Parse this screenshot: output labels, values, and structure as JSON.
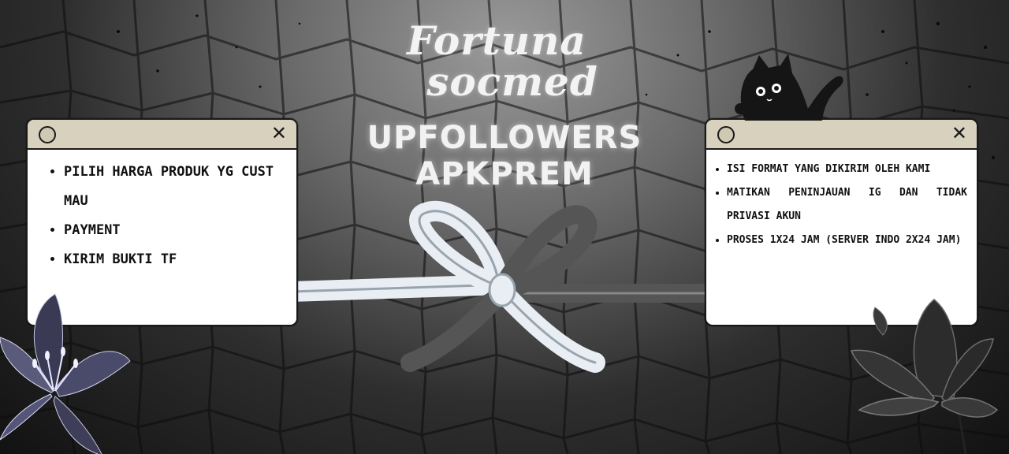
{
  "brand": {
    "line1": "Fortuna",
    "line2": "socmed"
  },
  "headline": {
    "line1": "UPFOLLOWERS",
    "line2": "APKPREM"
  },
  "left_window": {
    "close_symbol": "✕",
    "items": [
      "PILIH HARGA PRODUK YG CUST MAU",
      "PAYMENT",
      "KIRIM BUKTI TF"
    ]
  },
  "right_window": {
    "close_symbol": "✕",
    "items": [
      "ISI FORMAT YANG DIKIRIM OLEH KAMI",
      "MATIKAN PENINJAUAN IG DAN TIDAK PRIVASI AKUN",
      "PROSES 1X24 JAM (SERVER INDO 2X24 JAM)"
    ]
  },
  "decor": {
    "icons": [
      "ribbon-bow-icon",
      "black-cat-icon",
      "lily-flower-icon",
      "dark-flower-icon",
      "window-dot-icon",
      "close-icon"
    ],
    "colors": {
      "window_bar": "#d8d1bd",
      "window_body": "#ffffff",
      "text_dark": "#111111",
      "title_light": "#f3f3f3"
    }
  }
}
